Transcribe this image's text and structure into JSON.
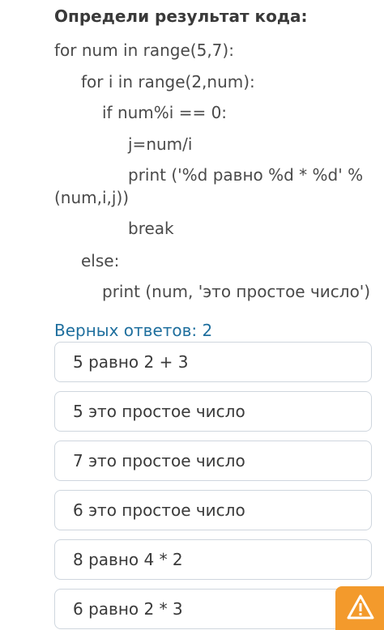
{
  "question": {
    "title": "Определи результат кода:",
    "code_lines": [
      "for num in range(5,7):",
      "for i in range(2,num):",
      "if num%i == 0:",
      "j=num/i",
      "print ('%d равно %d * %d' %",
      "(num,i,j))",
      "break",
      "else:",
      "print (num, 'это простое число')"
    ]
  },
  "correct_answers_label": "Верных ответов: 2",
  "options": [
    "5 равно 2 + 3",
    "5 это простое число",
    "7 это простое число",
    "6 это простое число",
    "8 равно 4 * 2",
    "6 равно 2 * 3"
  ],
  "report_icon": "warning-icon",
  "colors": {
    "accent_blue": "#1f6f9e",
    "warning_orange": "#f39a2c",
    "border": "#cfd6de"
  }
}
